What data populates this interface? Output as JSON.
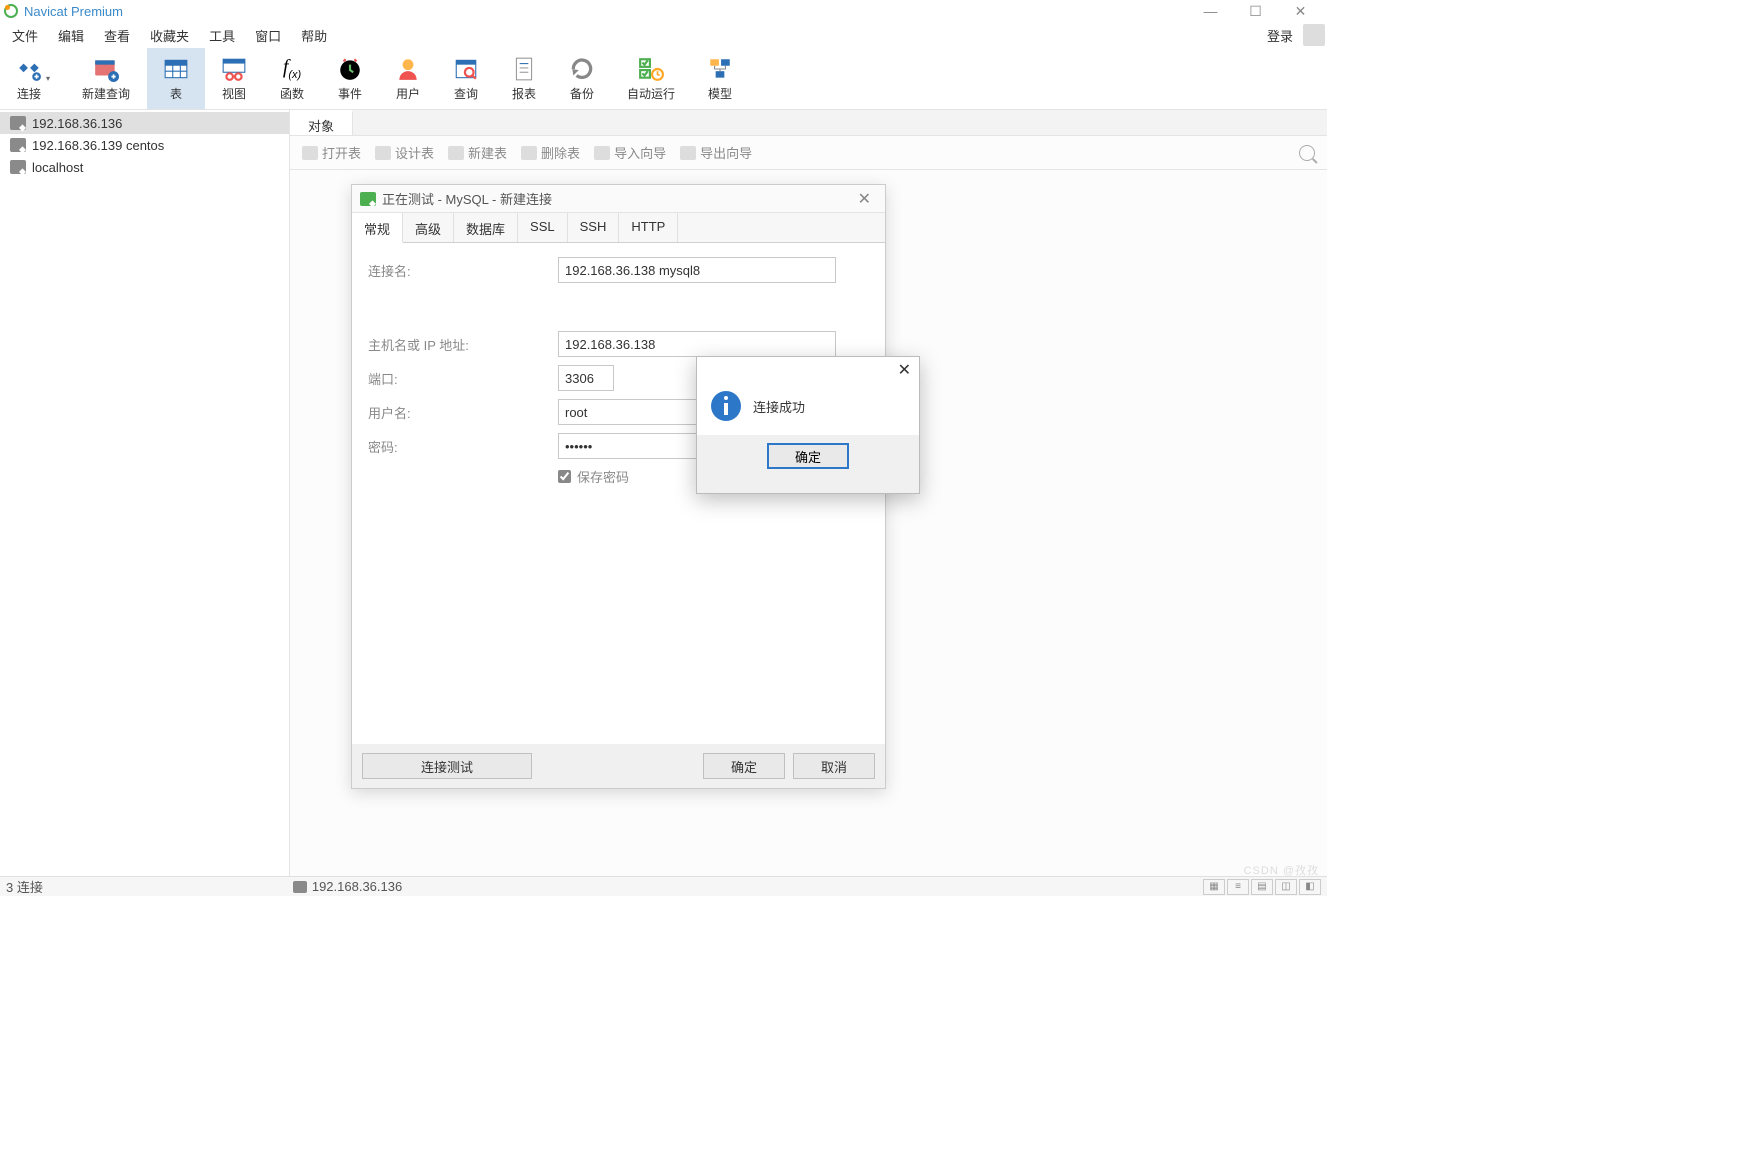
{
  "titlebar": {
    "app_name": "Navicat Premium"
  },
  "menu": {
    "items": [
      "文件",
      "编辑",
      "查看",
      "收藏夹",
      "工具",
      "窗口",
      "帮助"
    ],
    "login": "登录"
  },
  "toolbar": {
    "connect": "连接",
    "new_query": "新建查询",
    "table": "表",
    "view": "视图",
    "function": "函数",
    "event": "事件",
    "user": "用户",
    "query": "查询",
    "report": "报表",
    "backup": "备份",
    "auto_run": "自动运行",
    "model": "模型"
  },
  "sidebar": {
    "items": [
      {
        "label": "192.168.36.136",
        "selected": true
      },
      {
        "label": "192.168.36.139  centos",
        "selected": false
      },
      {
        "label": "localhost",
        "selected": false
      }
    ]
  },
  "content": {
    "tab": "对象",
    "subtoolbar": {
      "open": "打开表",
      "design": "设计表",
      "new": "新建表",
      "delete": "删除表",
      "import": "导入向导",
      "export": "导出向导"
    }
  },
  "dialog": {
    "title": "正在测试 - MySQL - 新建连接",
    "tabs": [
      "常规",
      "高级",
      "数据库",
      "SSL",
      "SSH",
      "HTTP"
    ],
    "fields": {
      "conn_name_label": "连接名:",
      "conn_name": "192.168.36.138 mysql8",
      "host_label": "主机名或 IP 地址:",
      "host": "192.168.36.138",
      "port_label": "端口:",
      "port": "3306",
      "user_label": "用户名:",
      "user": "root",
      "password_label": "密码:",
      "password": "••••••",
      "save_pw": "保存密码"
    },
    "buttons": {
      "test": "连接测试",
      "ok": "确定",
      "cancel": "取消"
    }
  },
  "msgbox": {
    "text": "连接成功",
    "ok": "确定"
  },
  "statusbar": {
    "left": "3 连接",
    "center": "192.168.36.136"
  },
  "watermark": "CSDN @孜孜"
}
